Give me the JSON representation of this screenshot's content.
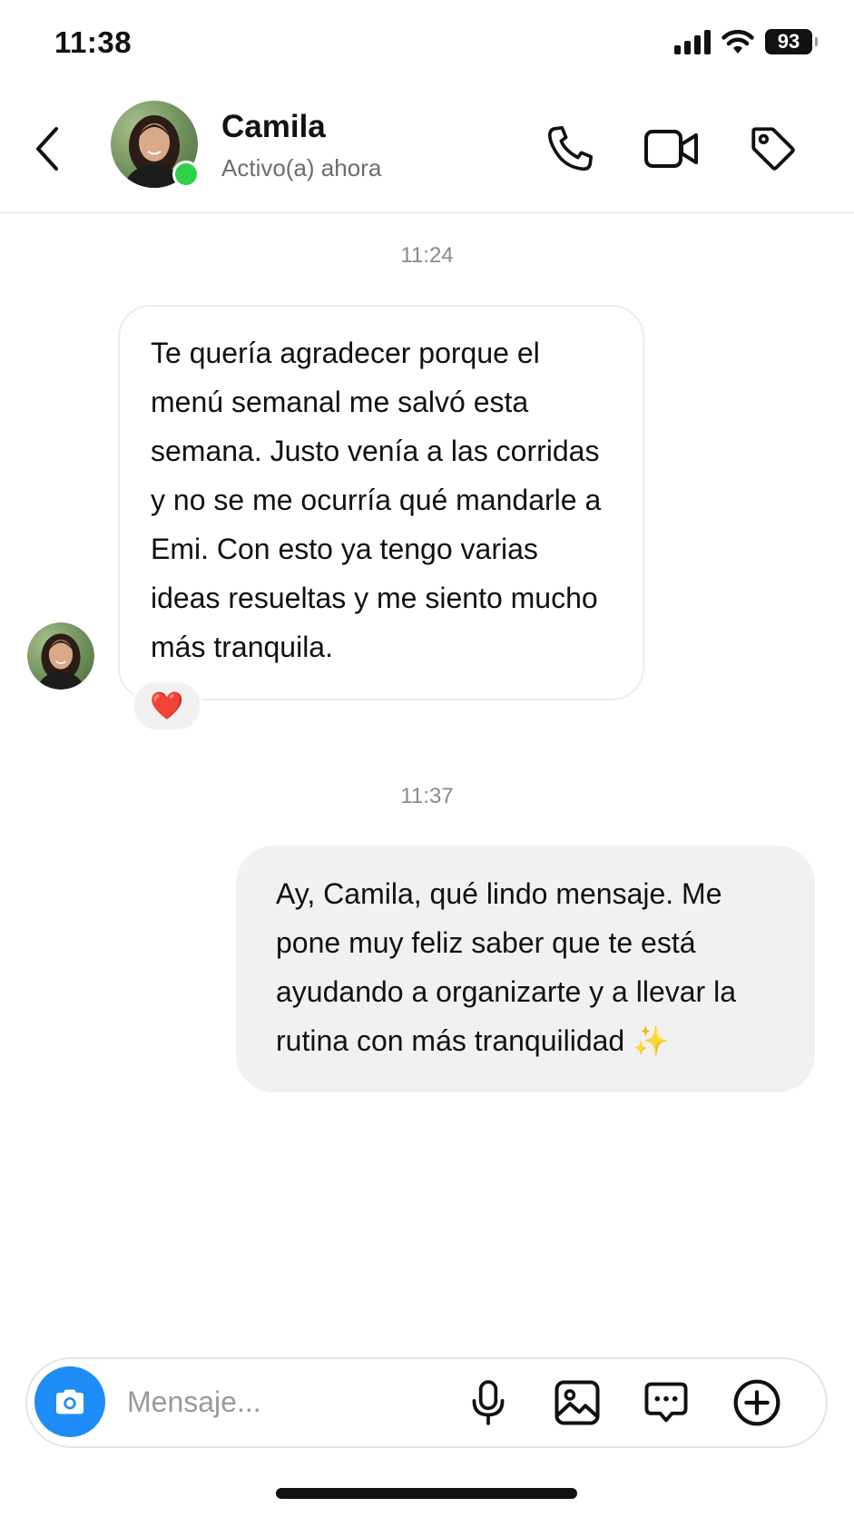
{
  "status_bar": {
    "time": "11:38",
    "battery": "93",
    "icons": [
      "signal-icon",
      "wifi-icon",
      "battery-icon"
    ]
  },
  "header": {
    "back_icon": "chevron-left-icon",
    "contact_name": "Camila",
    "contact_status": "Activo(a) ahora",
    "online_color": "#2fd04a",
    "actions": [
      "phone-icon",
      "video-camera-icon",
      "tag-icon"
    ]
  },
  "conversation": {
    "messages": [
      {
        "timestamp": "11:24",
        "direction": "incoming",
        "text": "Te quería agradecer porque el menú semanal me salvó esta semana. Justo venía a las corridas y no se me ocurría qué mandarle a Emi. Con esto ya tengo varias ideas resueltas y me siento mucho más tranquila.",
        "reaction": "❤️"
      },
      {
        "timestamp": "11:37",
        "direction": "outgoing",
        "text": "Ay, Camila, qué lindo mensaje. Me pone muy feliz saber que te está ayudando a organizarte y a llevar la rutina con más tranquilidad ✨"
      }
    ]
  },
  "composer": {
    "placeholder": "Mensaje...",
    "camera_color": "#1e8cf7",
    "actions": [
      "microphone-icon",
      "image-icon",
      "chat-bubble-icon",
      "plus-circle-icon"
    ]
  }
}
